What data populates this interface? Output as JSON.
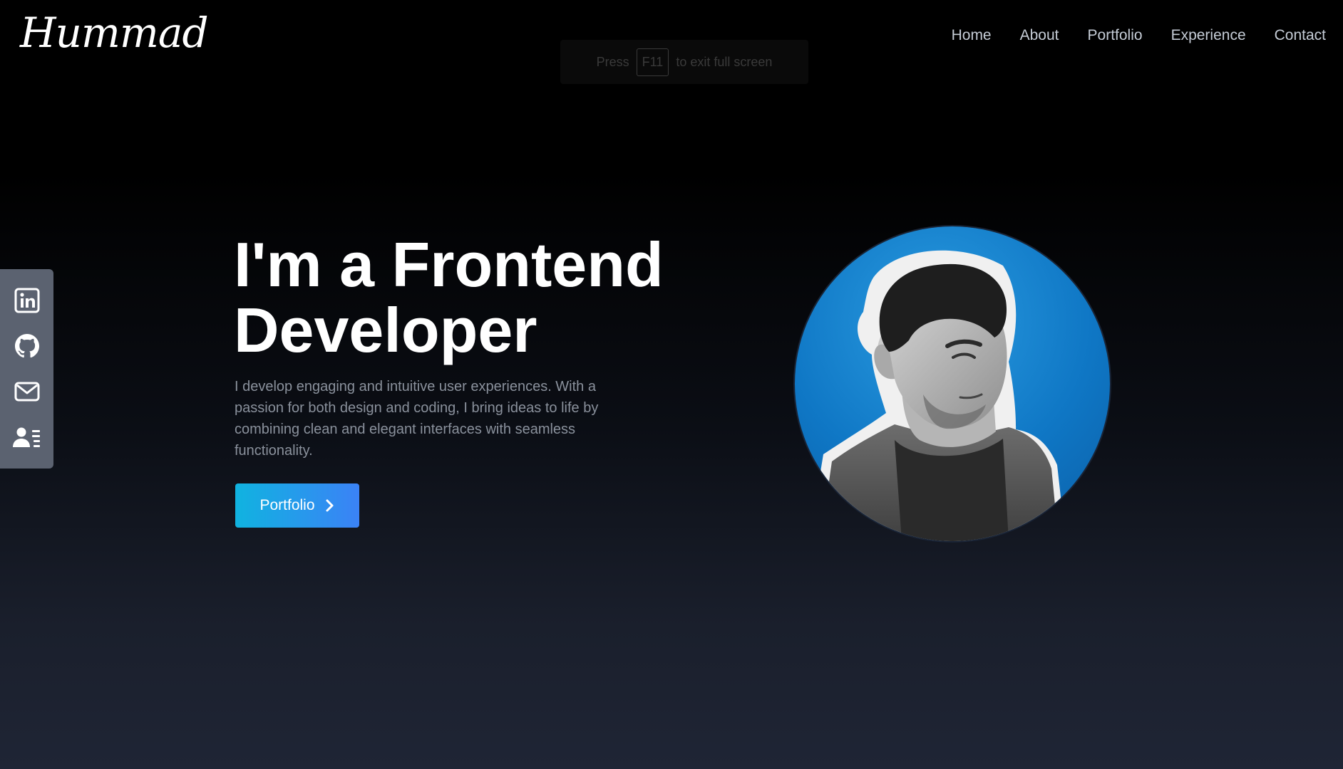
{
  "brand": {
    "logo_text": "Hummad"
  },
  "nav": {
    "items": [
      {
        "label": "Home"
      },
      {
        "label": "About"
      },
      {
        "label": "Portfolio"
      },
      {
        "label": "Experience"
      },
      {
        "label": "Contact"
      }
    ]
  },
  "fullscreen_notice": {
    "prefix": "Press",
    "key": "F11",
    "suffix": "to exit full screen"
  },
  "social": {
    "icons": [
      "linkedin-icon",
      "github-icon",
      "mail-icon",
      "contact-card-icon"
    ],
    "icon_color": "#ffffff",
    "panel_color": "#5b6270"
  },
  "hero": {
    "title_line1": "I'm a Frontend",
    "title_line2": "Developer",
    "description": "I develop engaging and intuitive user experiences. With a passion for both design and coding, I bring ideas to life by combining clean and elegant interfaces with seamless functionality.",
    "cta_label": "Portfolio",
    "cta_icon": "chevron-right-icon"
  },
  "colors": {
    "accent_start": "#10b3e0",
    "accent_end": "#3b82f6",
    "avatar_bg": "#0f77c5"
  }
}
